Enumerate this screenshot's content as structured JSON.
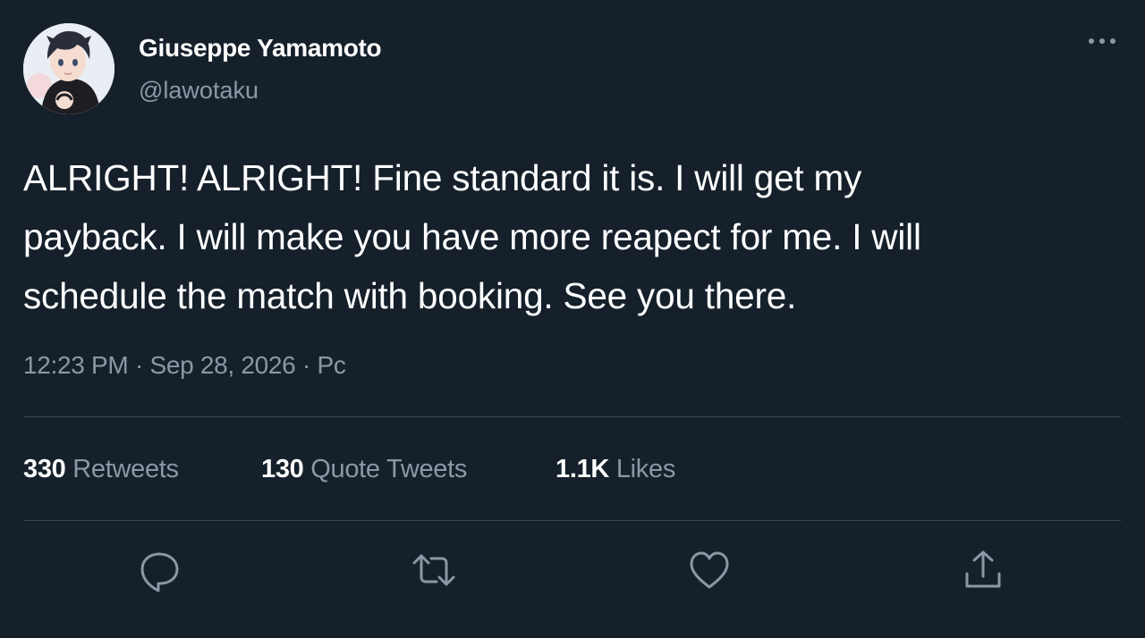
{
  "user": {
    "display_name": "Giuseppe Yamamoto",
    "handle": "@lawotaku",
    "avatar_icon": "user-avatar"
  },
  "tweet": {
    "text": "ALRIGHT! ALRIGHT! Fine standard it is. I will get my\npayback. I will make you have more reapect for me. I will\nschedule the match with booking. See you there.",
    "time": "12:23 PM",
    "separator": "·",
    "date": "Sep 28, 2026",
    "source": "Pc"
  },
  "stats": {
    "retweets_count": "330",
    "retweets_label": "Retweets",
    "quotes_count": "130",
    "quotes_label": "Quote Tweets",
    "likes_count": "1.1K",
    "likes_label": "Likes"
  },
  "actions": {
    "icons": [
      "reply-icon",
      "retweet-icon",
      "like-icon",
      "share-icon"
    ],
    "more_icon": "more-icon"
  },
  "colors": {
    "background": "#15202b",
    "primary_text": "#ffffff",
    "secondary_text": "#8b98a5",
    "divider": "#38444d"
  }
}
